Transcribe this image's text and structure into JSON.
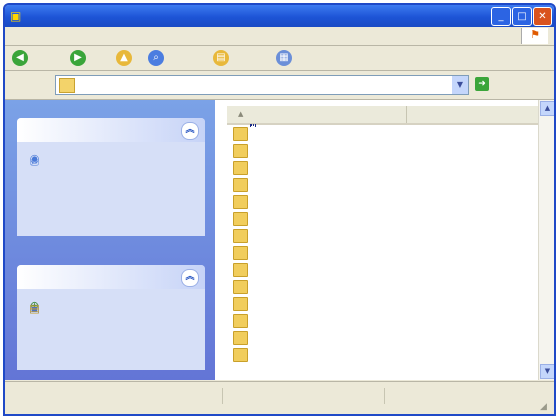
{
  "window": {
    "title": "",
    "controls": {
      "minimize": "_",
      "maximize": "□",
      "close": "✕"
    }
  },
  "menubar": {
    "items": [
      "",
      "",
      "",
      "",
      "",
      ""
    ]
  },
  "toolbar": {
    "back_label": "",
    "forward_label": "",
    "search_label": "",
    "folders_label": ""
  },
  "address": {
    "label": "",
    "value": "",
    "go_label": "",
    "links_label": ""
  },
  "tasks_panel": {
    "title": "",
    "items": [
      {
        "icon": "folder-tasks-icon",
        "label": ""
      },
      {
        "icon": "add-printer-icon",
        "label": ""
      },
      {
        "icon": "search-icon",
        "label": ""
      }
    ]
  },
  "other_places_panel": {
    "title": "",
    "items": [
      {
        "icon": "network-icon",
        "label": ""
      },
      {
        "icon": "computer-icon",
        "label": ""
      },
      {
        "icon": "shared-folder-icon",
        "label": ""
      }
    ]
  },
  "file_list": {
    "columns": {
      "name": "",
      "type": ""
    },
    "rows": [
      {
        "name": "",
        "type": ""
      },
      {
        "name": "",
        "type": ""
      },
      {
        "name": "",
        "type": ""
      },
      {
        "name": "",
        "type": ""
      },
      {
        "name": "",
        "type": ""
      },
      {
        "name": "",
        "type": ""
      },
      {
        "name": "",
        "type": ""
      },
      {
        "name": "",
        "type": ""
      },
      {
        "name": "",
        "type": ""
      },
      {
        "name": "",
        "type": ""
      },
      {
        "name": "",
        "type": ""
      },
      {
        "name": "",
        "type": ""
      },
      {
        "name": "",
        "type": ""
      },
      {
        "name": "",
        "type": ""
      }
    ]
  },
  "statusbar": {
    "left": "",
    "middle": "",
    "right": ""
  },
  "colors": {
    "title_bar": "#1d54d6",
    "task_pane": "#6375d6",
    "close_button": "#d9531e"
  }
}
